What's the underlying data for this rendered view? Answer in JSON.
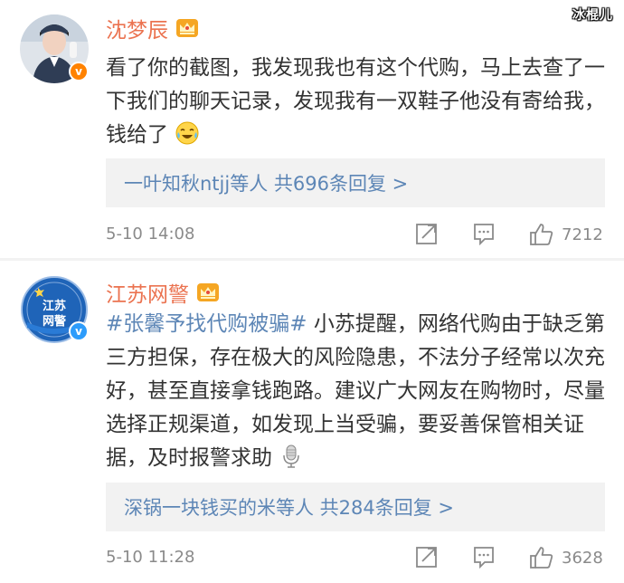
{
  "watermark": "冰棍儿",
  "comments": [
    {
      "username": "沈梦辰",
      "text_before": "看了你的截图，我发现我也有这个代购，马上去查了一下我们的聊天记录，发现我有一双鞋子他没有寄给我，钱给了",
      "reply_summary": "一叶知秋ntjj等人  共696条回复 >",
      "time": "5-10 14:08",
      "likes": "7212",
      "verify_color": "#ff8200",
      "icons": [
        "crown-badge-icon",
        "crying-laugh-emoji-icon",
        "share-icon",
        "comment-icon",
        "like-icon"
      ]
    },
    {
      "username": "江苏网警",
      "avatar_text_top": "江苏",
      "avatar_text_bottom": "网警",
      "hashtag": "#张馨予找代购被骗#",
      "text_after": " 小苏提醒，网络代购由于缺乏第三方担保，存在极大的风险隐患，不法分子经常以次充好，甚至直接拿钱跑路。建议广大网友在购物时，尽量选择正规渠道，如发现上当受骗，要妥善保管相关证据，及时报警求助",
      "reply_summary": "深锅一块钱买的米等人  共284条回复 >",
      "time": "5-10 11:28",
      "likes": "3628",
      "verify_color": "#2d9cfb",
      "icons": [
        "crown-badge-icon",
        "microphone-emoji-icon",
        "share-icon",
        "comment-icon",
        "like-icon"
      ]
    }
  ],
  "colors": {
    "username": "#eb7350",
    "link": "#5d86b6",
    "reply_bg": "#f2f2f2",
    "meta": "#8a8a8a"
  }
}
